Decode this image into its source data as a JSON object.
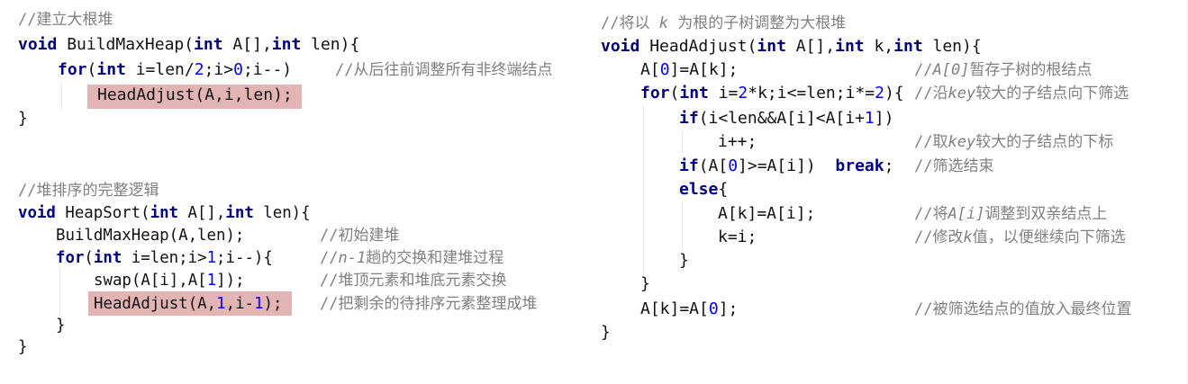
{
  "colors": {
    "keyword": "#000080",
    "number": "#0000ff",
    "comment": "#808080",
    "highlight": "#e3b4b4"
  },
  "left": {
    "lines": [
      {
        "code": [],
        "comment": [
          [
            "c",
            "//建立大根堆"
          ]
        ]
      },
      {
        "code": [
          [
            "k",
            "void"
          ],
          [
            "p",
            " BuildMaxHeap("
          ],
          [
            "k",
            "int"
          ],
          [
            "p",
            " A[],"
          ],
          [
            "k",
            "int"
          ],
          [
            "p",
            " len){"
          ]
        ],
        "comment": []
      },
      {
        "code": [
          [
            "k",
            "for"
          ],
          [
            "p",
            "("
          ],
          [
            "k",
            "int"
          ],
          [
            "p",
            " i=len/"
          ],
          [
            "n",
            "2"
          ],
          [
            "p",
            ";i>"
          ],
          [
            "n",
            "0"
          ],
          [
            "p",
            ";i--)"
          ]
        ],
        "comment": [
          [
            "c",
            "//从后往前调整所有非终端结点"
          ]
        ]
      },
      {
        "code": [
          [
            "p",
            "HeadAdjust(A,i,len);"
          ]
        ],
        "comment": []
      },
      {
        "code": [
          [
            "p",
            "}"
          ]
        ],
        "comment": []
      },
      {
        "code": [],
        "comment": [
          [
            "c",
            "//堆排序的完整逻辑"
          ]
        ]
      },
      {
        "code": [
          [
            "k",
            "void"
          ],
          [
            "p",
            " HeapSort("
          ],
          [
            "k",
            "int"
          ],
          [
            "p",
            " A[],"
          ],
          [
            "k",
            "int"
          ],
          [
            "p",
            " len){"
          ]
        ],
        "comment": []
      },
      {
        "code": [
          [
            "p",
            "BuildMaxHeap(A,len);"
          ]
        ],
        "comment": [
          [
            "c",
            "//初始建堆"
          ]
        ]
      },
      {
        "code": [
          [
            "k",
            "for"
          ],
          [
            "p",
            "("
          ],
          [
            "k",
            "int"
          ],
          [
            "p",
            " i=len;i>"
          ],
          [
            "n",
            "1"
          ],
          [
            "p",
            ";i--){"
          ]
        ],
        "comment": [
          [
            "c",
            "//"
          ],
          [
            "ci",
            "n-1"
          ],
          [
            "c",
            "趟的交换和建堆过程"
          ]
        ]
      },
      {
        "code": [
          [
            "p",
            "swap(A[i],A["
          ],
          [
            "n",
            "1"
          ],
          [
            "p",
            "]);"
          ]
        ],
        "comment": [
          [
            "c",
            "//堆顶元素和堆底元素交换"
          ]
        ]
      },
      {
        "code": [
          [
            "p",
            "HeadAdjust(A,"
          ],
          [
            "n",
            "1"
          ],
          [
            "p",
            ",i-"
          ],
          [
            "n",
            "1"
          ],
          [
            "p",
            ");"
          ]
        ],
        "comment": [
          [
            "c",
            "//把剩余的待排序元素整理成堆"
          ]
        ]
      },
      {
        "code": [
          [
            "p",
            "}"
          ]
        ],
        "comment": []
      },
      {
        "code": [
          [
            "p",
            "}"
          ]
        ],
        "comment": []
      }
    ]
  },
  "right": {
    "lines": [
      {
        "code": [],
        "comment": [
          [
            "c",
            "//将以 "
          ],
          [
            "ci",
            "k"
          ],
          [
            "c",
            " 为根的子树调整为大根堆"
          ]
        ]
      },
      {
        "code": [
          [
            "k",
            "void"
          ],
          [
            "p",
            " HeadAdjust("
          ],
          [
            "k",
            "int"
          ],
          [
            "p",
            " A[],"
          ],
          [
            "k",
            "int"
          ],
          [
            "p",
            " k,"
          ],
          [
            "k",
            "int"
          ],
          [
            "p",
            " len){"
          ]
        ],
        "comment": []
      },
      {
        "code": [
          [
            "p",
            "A["
          ],
          [
            "n",
            "0"
          ],
          [
            "p",
            "]=A[k];"
          ]
        ],
        "comment": [
          [
            "c",
            "//"
          ],
          [
            "ci",
            "A[0]"
          ],
          [
            "c",
            "暂存子树的根结点"
          ]
        ]
      },
      {
        "code": [
          [
            "k",
            "for"
          ],
          [
            "p",
            "("
          ],
          [
            "k",
            "int"
          ],
          [
            "p",
            " i="
          ],
          [
            "n",
            "2"
          ],
          [
            "p",
            "*k;i<=len;i*="
          ],
          [
            "n",
            "2"
          ],
          [
            "p",
            "){"
          ]
        ],
        "comment": [
          [
            "c",
            "//沿"
          ],
          [
            "ci",
            "key"
          ],
          [
            "c",
            "较大的子结点向下筛选"
          ]
        ]
      },
      {
        "code": [
          [
            "k",
            "if"
          ],
          [
            "p",
            "(i<len&&A[i]<A[i+"
          ],
          [
            "n",
            "1"
          ],
          [
            "p",
            "])"
          ]
        ],
        "comment": []
      },
      {
        "code": [
          [
            "p",
            "i++;"
          ]
        ],
        "comment": [
          [
            "c",
            "//取"
          ],
          [
            "ci",
            "key"
          ],
          [
            "c",
            "较大的子结点的下标"
          ]
        ]
      },
      {
        "code": [
          [
            "k",
            "if"
          ],
          [
            "p",
            "(A["
          ],
          [
            "n",
            "0"
          ],
          [
            "p",
            "]>=A[i])  "
          ],
          [
            "k",
            "break"
          ],
          [
            "p",
            ";"
          ]
        ],
        "comment": [
          [
            "c",
            "//筛选结束"
          ]
        ]
      },
      {
        "code": [
          [
            "k",
            "else"
          ],
          [
            "p",
            "{"
          ]
        ],
        "comment": []
      },
      {
        "code": [
          [
            "p",
            "A[k]=A[i];"
          ]
        ],
        "comment": [
          [
            "c",
            "//将"
          ],
          [
            "ci",
            "A[i]"
          ],
          [
            "c",
            "调整到双亲结点上"
          ]
        ]
      },
      {
        "code": [
          [
            "p",
            "k=i;"
          ]
        ],
        "comment": [
          [
            "c",
            "//修改"
          ],
          [
            "ci",
            "k"
          ],
          [
            "c",
            "值，以便继续向下筛选"
          ]
        ]
      },
      {
        "code": [
          [
            "p",
            "}"
          ]
        ],
        "comment": []
      },
      {
        "code": [
          [
            "p",
            "}"
          ]
        ],
        "comment": []
      },
      {
        "code": [
          [
            "p",
            "A[k]=A["
          ],
          [
            "n",
            "0"
          ],
          [
            "p",
            "];"
          ]
        ],
        "comment": [
          [
            "c",
            "//被筛选结点的值放入最终位置"
          ]
        ]
      },
      {
        "code": [
          [
            "p",
            "}"
          ]
        ],
        "comment": []
      }
    ]
  }
}
